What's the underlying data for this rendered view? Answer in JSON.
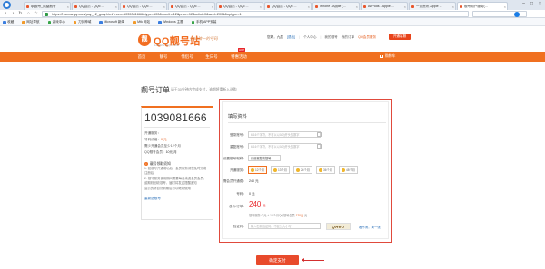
{
  "browser": {
    "tabs": [
      {
        "label": "qq靓号_凤凰靓号"
      },
      {
        "label": "QQ会员 - QQ5 ..."
      },
      {
        "label": "QQ会员 - QQ5 ..."
      },
      {
        "label": "QQ会员 - QQ5 ..."
      },
      {
        "label": "QQ会员 - QQ5 ..."
      },
      {
        "label": "QQ会员 - QQ5 ..."
      },
      {
        "label": "iPhone - Apple (..."
      },
      {
        "label": "AirPods - Apple ..."
      },
      {
        "label": "一点资讯 Apple ..."
      },
      {
        "label": "靓号用户服务(..."
      }
    ],
    "active_tab_index": 9,
    "url": "https://haoma.qq.com/pay_v2_gray.html?num=1039081666&type=100&month=12&price=12&artist=0&acid=2001&optype=1",
    "bookmarks": [
      {
        "label": "收藏",
        "color": "#3a7ee0"
      },
      {
        "label": "网址导航",
        "color": "#f29b2b"
      },
      {
        "label": "游戏中心",
        "color": "#3aa64a"
      },
      {
        "label": "刀剑神域",
        "color": "#f29b2b"
      },
      {
        "label": "Microsoft 新闻",
        "color": "#3a7ee0"
      },
      {
        "label": "Mtk 网站",
        "color": "#f29b2b"
      },
      {
        "label": "Windows 主题",
        "color": "#3a7ee0"
      },
      {
        "label": "手机 APP安装",
        "color": "#3aa64a"
      }
    ]
  },
  "header": {
    "logo_icon": "靓",
    "logo_title": "QQ靓号站",
    "logo_sub": "HAOMA.QQ.COM",
    "slogan": "拍出独一的号码",
    "account": "您好，九居",
    "logout": "[退出]",
    "member_link": "个人中心",
    "my_numbers": "我的靓号",
    "my_orders": "我的订单",
    "alt_account": "QQ会员服务",
    "help_button": "开通客服"
  },
  "nav": {
    "items": [
      {
        "label": "首页"
      },
      {
        "label": "靓号"
      },
      {
        "label": "情侣号"
      },
      {
        "label": "生日号"
      },
      {
        "label": "特惠活动"
      }
    ],
    "badge": "HOT",
    "cart": "购物车"
  },
  "order": {
    "title": "靓号订单",
    "subtitle": "请于30分钟内完成支付，逾期将重新入选购",
    "qq_number": "1039081666",
    "service_line": "开通服务：",
    "price_label": "号码价格：",
    "price_value": "0 元",
    "member_line": "需少开通会员至少12个月",
    "member_value_label": "QQ靓号会员：",
    "member_value": "10元/月",
    "tips_title": "靓号领取须知",
    "tips": [
      "1. 如靓号开通成功后，会员服务请您及时完成",
      "   注册后",
      "2. 靓号服务使用期间需要每月续费会员会员，",
      "   逾期则回收靓号，届时将发送提醒通知",
      "   会员的请自然到期后可以继续使用"
    ],
    "back_link": "重新选靓号"
  },
  "form": {
    "title": "填写资料",
    "login_qq_label": "登录账号：",
    "login_qq_placeholder": "6-16个字符，不可以以0(0)开头的数字",
    "confirm_qq_label": "重复账号：",
    "confirm_qq_placeholder": "6-16个字符，不可以以0(0)开头的数字",
    "nickname_label": "设置靓号昵称：",
    "nickname_value": "请设置您的靓号",
    "period_label": "开通服务：",
    "periods": [
      "12个月",
      "13个月",
      "24个月",
      "36个月",
      "48个月"
    ],
    "selected_period_index": 0,
    "member_fee_label": "需会员开通费：",
    "member_fee_value": "240 元",
    "number_fee_label": "号码：",
    "number_fee_value": "0 元",
    "total_label": "总价/订单：",
    "total_value": "240",
    "total_unit": "元",
    "breakdown_prefix": "靓号服务 0 元 + 12个月QQ靓号会员 ",
    "breakdown_amount": "120元",
    "breakdown_suffix": " 元",
    "captcha_label": "验证码：",
    "captcha_placeholder": "输入右侧验证码，不区分大小写",
    "captcha_text": "QHeD",
    "refresh_link": "看不清，换一张",
    "pay_button": "确定支付"
  }
}
